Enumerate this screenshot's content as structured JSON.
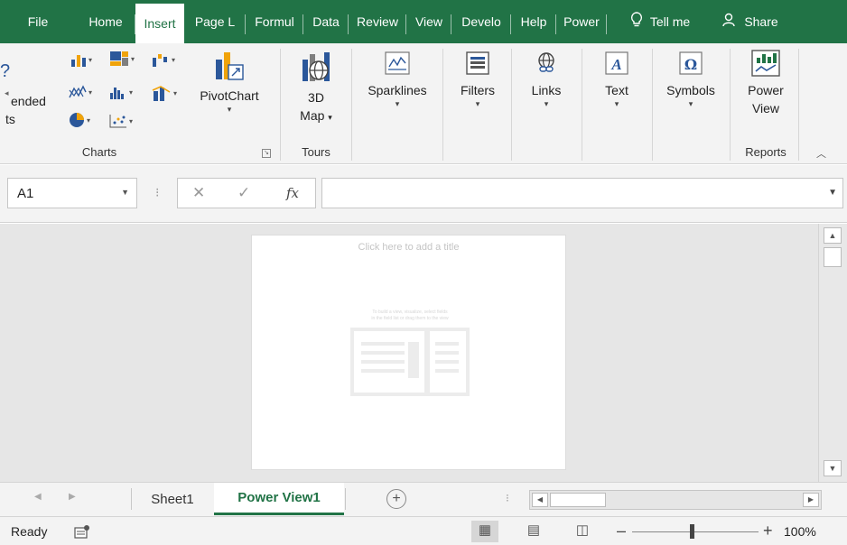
{
  "tabs": {
    "file": "File",
    "home": "Home",
    "insert": "Insert",
    "page_layout": "Page L",
    "formulas": "Formul",
    "data": "Data",
    "review": "Review",
    "view": "View",
    "developer": "Develo",
    "help": "Help",
    "power": "Power",
    "tell_me": "Tell me",
    "share": "Share"
  },
  "ribbon": {
    "recommended_charts_line1": "ended",
    "recommended_charts_line2": "ts",
    "pivotchart": "PivotChart",
    "map_line1": "3D",
    "map_line2": "Map",
    "sparklines": "Sparklines",
    "filters": "Filters",
    "links": "Links",
    "text": "Text",
    "symbols": "Symbols",
    "power_view_line1": "Power",
    "power_view_line2": "View",
    "groups": {
      "charts": "Charts",
      "tours": "Tours",
      "reports": "Reports"
    }
  },
  "formula_bar": {
    "name_box": "A1",
    "formula_value": "",
    "fx": "fx"
  },
  "power_view": {
    "title_placeholder": "Click here to add a title",
    "hint_line1": "To build a view, visualize, select fields",
    "hint_line2": "in the field list or drag them to the view"
  },
  "sheets": [
    {
      "label": "Sheet1",
      "active": false
    },
    {
      "label": "Power View1",
      "active": true
    }
  ],
  "status": {
    "ready": "Ready",
    "zoom": "100%"
  },
  "colors": {
    "accent": "#217346",
    "chrome": "#f3f3f3",
    "canvas": "#e6e6e6"
  }
}
